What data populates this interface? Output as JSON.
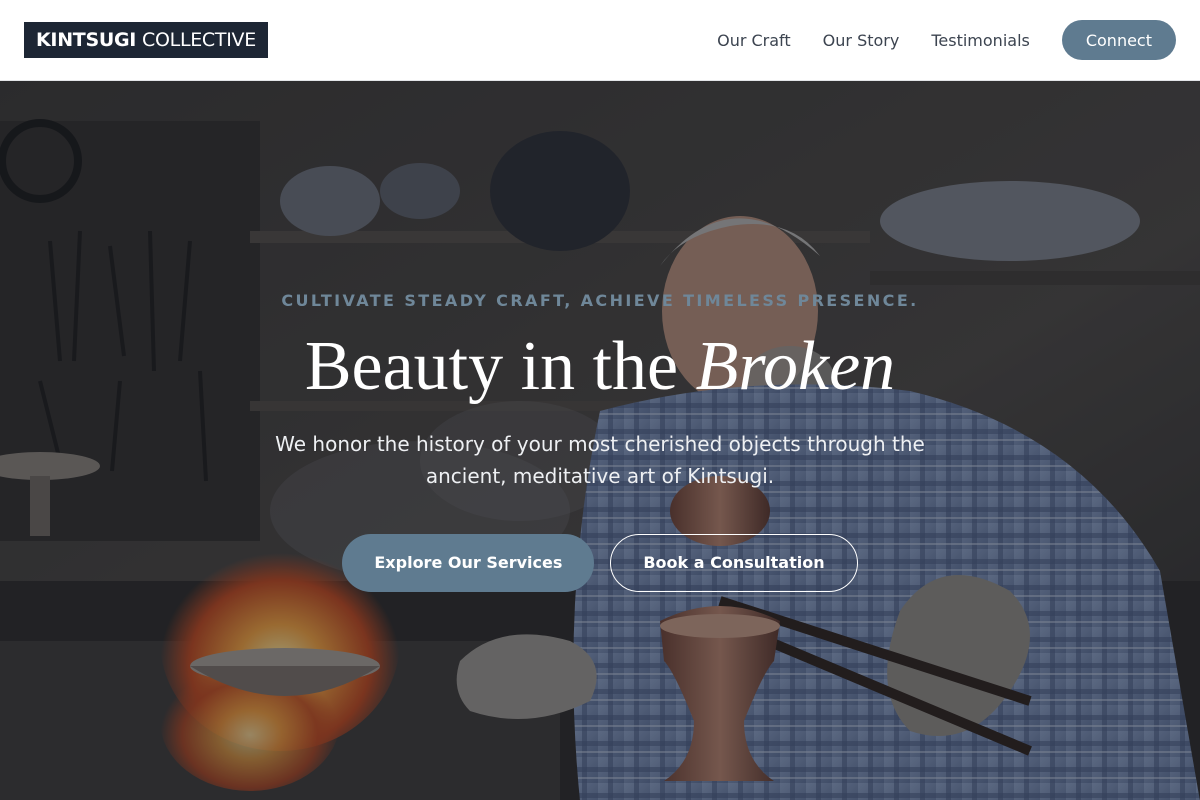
{
  "header": {
    "logo_bold": "KINTSUGI",
    "logo_light": "COLLECTIVE",
    "nav": [
      "Our Craft",
      "Our Story",
      "Testimonials"
    ],
    "connect_label": "Connect"
  },
  "hero": {
    "eyebrow": "CULTIVATE STEADY CRAFT, ACHIEVE TIMELESS PRESENCE.",
    "title_main": "Beauty in the ",
    "title_italic": "Broken",
    "subtitle": "We honor the history of your most cherished objects through the ancient, meditative art of Kintsugi.",
    "primary_cta": "Explore Our Services",
    "secondary_cta": "Book a Consultation"
  },
  "colors": {
    "accent": "#5f7b90",
    "logo_bg": "#1d2634",
    "overlay": "#181c26"
  }
}
